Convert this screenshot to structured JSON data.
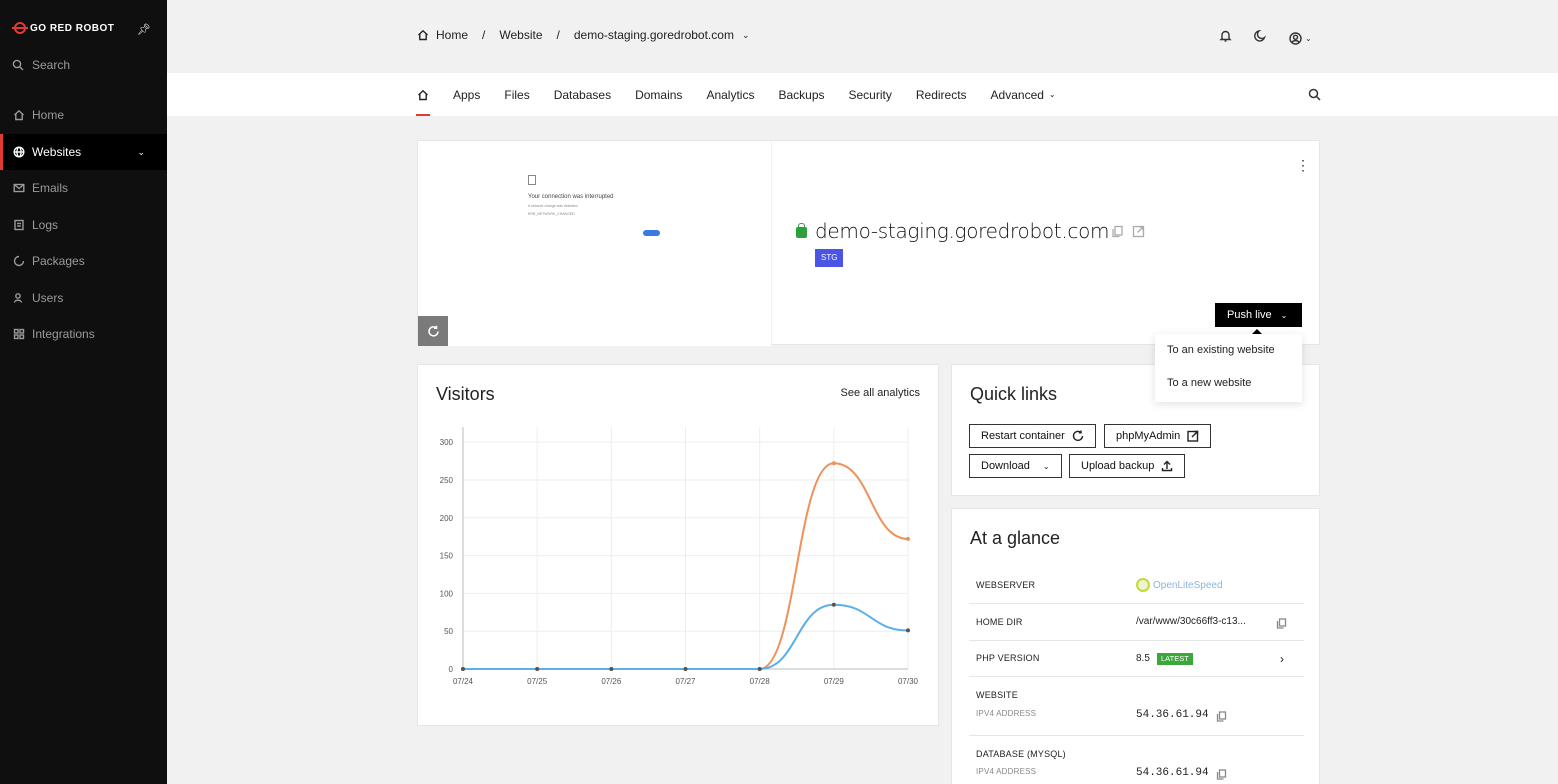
{
  "sidebar": {
    "logo": "GO RED ROBOT",
    "search_label": "Search",
    "items": [
      {
        "label": "Home"
      },
      {
        "label": "Websites"
      },
      {
        "label": "Emails"
      },
      {
        "label": "Logs"
      },
      {
        "label": "Packages"
      },
      {
        "label": "Users"
      },
      {
        "label": "Integrations"
      }
    ]
  },
  "breadcrumb": {
    "home": "Home",
    "website": "Website",
    "domain": "demo-staging.goredrobot.com"
  },
  "tabs": [
    "Apps",
    "Files",
    "Databases",
    "Domains",
    "Analytics",
    "Backups",
    "Security",
    "Redirects",
    "Advanced"
  ],
  "site": {
    "name": "demo-staging.goredrobot.com",
    "badge": "STG",
    "push_label": "Push live",
    "preview_title": "Your connection was interrupted",
    "preview_sub": "A network change was detected.",
    "preview_code": "ERR_NETWORK_CHANGED"
  },
  "push_menu": [
    "To an existing website",
    "To a new website"
  ],
  "visitors": {
    "title": "Visitors",
    "see_all": "See all analytics"
  },
  "chart_data": {
    "type": "line",
    "categories": [
      "07/24",
      "07/25",
      "07/26",
      "07/27",
      "07/28",
      "07/29",
      "07/30"
    ],
    "series": [
      {
        "values": [
          0,
          0,
          0,
          0,
          0,
          272,
          172
        ],
        "color": "#f0915a"
      },
      {
        "values": [
          0,
          0,
          0,
          0,
          0,
          85,
          51
        ],
        "color": "#5ab0e8"
      }
    ],
    "yticks": [
      0,
      50,
      100,
      150,
      200,
      250,
      300
    ],
    "ylim": [
      0,
      320
    ],
    "grid": true
  },
  "quick_links": {
    "title": "Quick links",
    "restart": "Restart container",
    "phpmyadmin": "phpMyAdmin",
    "download": "Download",
    "upload": "Upload backup"
  },
  "glance": {
    "title": "At a glance",
    "webserver_label": "WEBSERVER",
    "webserver_value": "OpenLiteSpeed",
    "homedir_label": "HOME DIR",
    "homedir_value": "/var/www/30c66ff3-c13...",
    "php_label": "PHP VERSION",
    "php_value": "8.5",
    "php_badge": "LATEST",
    "website_label": "WEBSITE",
    "website_sub": "IPV4 ADDRESS",
    "website_ip": "54.36.61.94",
    "db_label": "DATABASE (MYSQL)",
    "db_sub": "IPV4 ADDRESS",
    "db_ip": "54.36.61.94"
  }
}
